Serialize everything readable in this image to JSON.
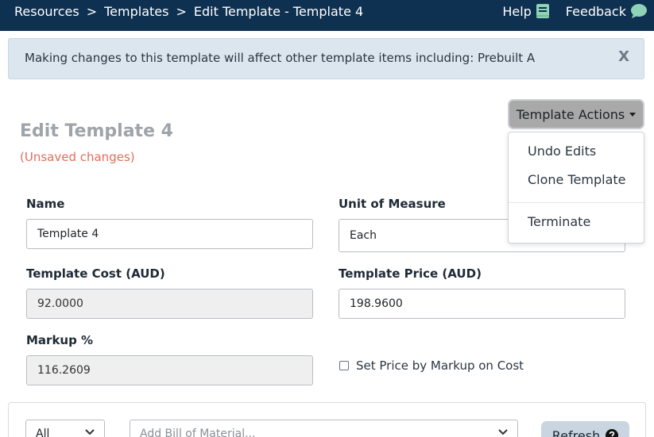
{
  "breadcrumb": {
    "items": [
      "Resources",
      "Templates",
      "Edit Template - Template 4"
    ],
    "separator": ">"
  },
  "topnav": {
    "help_label": "Help",
    "feedback_label": "Feedback"
  },
  "alert": {
    "message": "Making changes to this template will affect other template items including: Prebuilt A",
    "close_label": "X"
  },
  "actions": {
    "button_label": "Template Actions",
    "menu": [
      "Undo Edits",
      "Clone Template",
      "Terminate"
    ]
  },
  "page": {
    "title": "Edit Template 4",
    "status": "(Unsaved changes)"
  },
  "form": {
    "name_label": "Name",
    "name_value": "Template 4",
    "uom_label": "Unit of Measure",
    "uom_value": "Each",
    "cost_label": "Template Cost (AUD)",
    "cost_value": "92.0000",
    "price_label": "Template Price (AUD)",
    "price_value": "198.9600",
    "markup_label": "Markup %",
    "markup_value": "116.2609",
    "set_price_label": "Set Price by Markup on Cost",
    "set_price_checked": false
  },
  "bom": {
    "filter_value": "All",
    "add_placeholder": "Add Bill of Material...",
    "refresh_label": "Refresh"
  },
  "colors": {
    "topbar": "#0f3151",
    "alert_bg": "#dbe6ef",
    "unsaved": "#e26d5c",
    "actions_bg": "#a9a9a9",
    "refresh_bg": "#c9d5e0"
  }
}
